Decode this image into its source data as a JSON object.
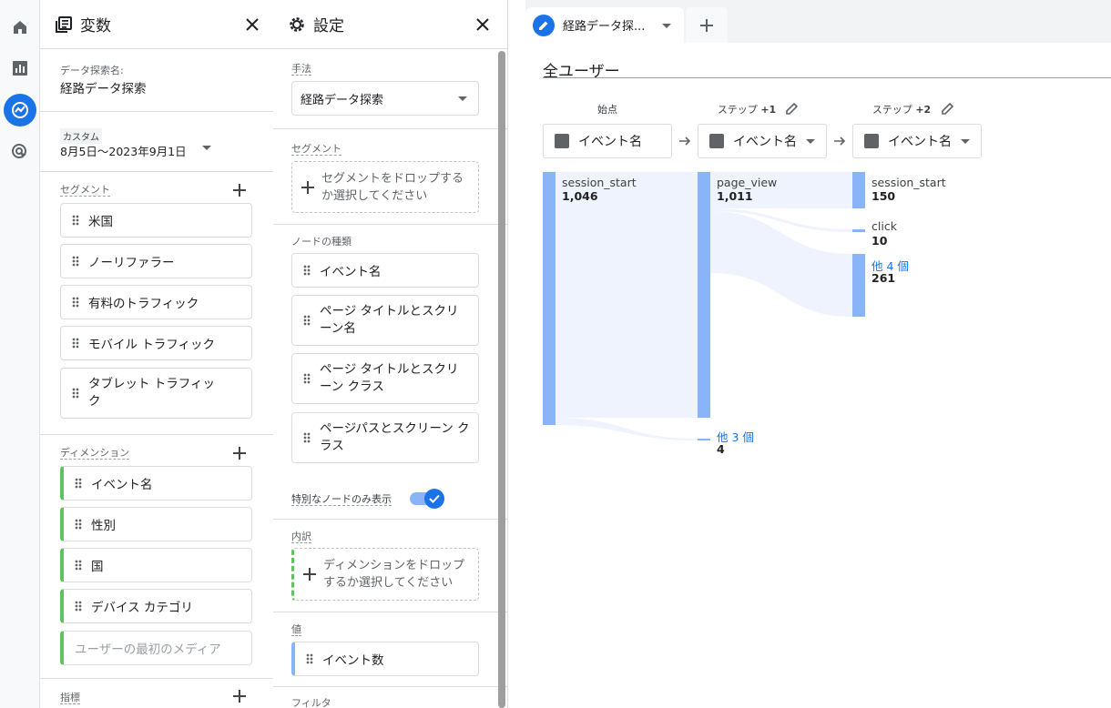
{
  "rail": {
    "items": [
      {
        "icon": "home-icon"
      },
      {
        "icon": "reports-icon"
      },
      {
        "icon": "explore-icon",
        "active": true
      },
      {
        "icon": "advertising-icon"
      }
    ]
  },
  "variables": {
    "title": "変数",
    "explore_name_label": "データ探索名:",
    "explore_name": "経路データ探索",
    "date_label": "カスタム",
    "date_range": "8月5日～2023年9月1日",
    "segments_label": "セグメント",
    "segments": [
      "米国",
      "ノーリファラー",
      "有料のトラフィック",
      "モバイル トラフィック",
      "タブレット トラフィック"
    ],
    "dimensions_label": "ディメンション",
    "dimensions": [
      "イベント名",
      "性別",
      "国",
      "デバイス カテゴリ"
    ],
    "dimension_placeholder": "ユーザーの最初のメディア",
    "metrics_label": "指標"
  },
  "settings": {
    "title": "設定",
    "technique_label": "手法",
    "technique_value": "経路データ探索",
    "segment_label": "セグメント",
    "segment_drop": "セグメントをドロップするか選択してください",
    "node_types_label": "ノードの種類",
    "node_types": [
      "イベント名",
      "ページ タイトルとスクリーン名",
      "ページ タイトルとスクリーン クラス",
      "ページパスとスクリーン クラス"
    ],
    "special_nodes_label": "特別なノードのみ表示",
    "special_nodes_on": true,
    "breakdown_label": "内訳",
    "breakdown_drop": "ディメンションをドロップするか選択してください",
    "value_label": "値",
    "value_chip": "イベント数",
    "filter_label": "フィルタ"
  },
  "main": {
    "tab_label": "経路データ探...",
    "segment_title": "全ユーザー",
    "columns": [
      {
        "header": "始点",
        "step": "",
        "node": "イベント名"
      },
      {
        "header": "ステップ",
        "step": "+1",
        "node": "イベント名"
      },
      {
        "header": "ステップ",
        "step": "+2",
        "node": "イベント名"
      }
    ],
    "nodes": {
      "c0": [
        {
          "name": "session_start",
          "value": "1,046"
        }
      ],
      "c1": [
        {
          "name": "page_view",
          "value": "1,011"
        },
        {
          "name": "他 3 個",
          "value": "4"
        }
      ],
      "c2": [
        {
          "name": "session_start",
          "value": "150"
        },
        {
          "name": "click",
          "value": "10"
        },
        {
          "name": "他 4 個",
          "value": "261"
        }
      ]
    }
  },
  "colors": {
    "accent": "#1a73e8",
    "bar": "#8ab4f8",
    "flow": "#eef3fd",
    "dimension": "#5fc25f"
  }
}
